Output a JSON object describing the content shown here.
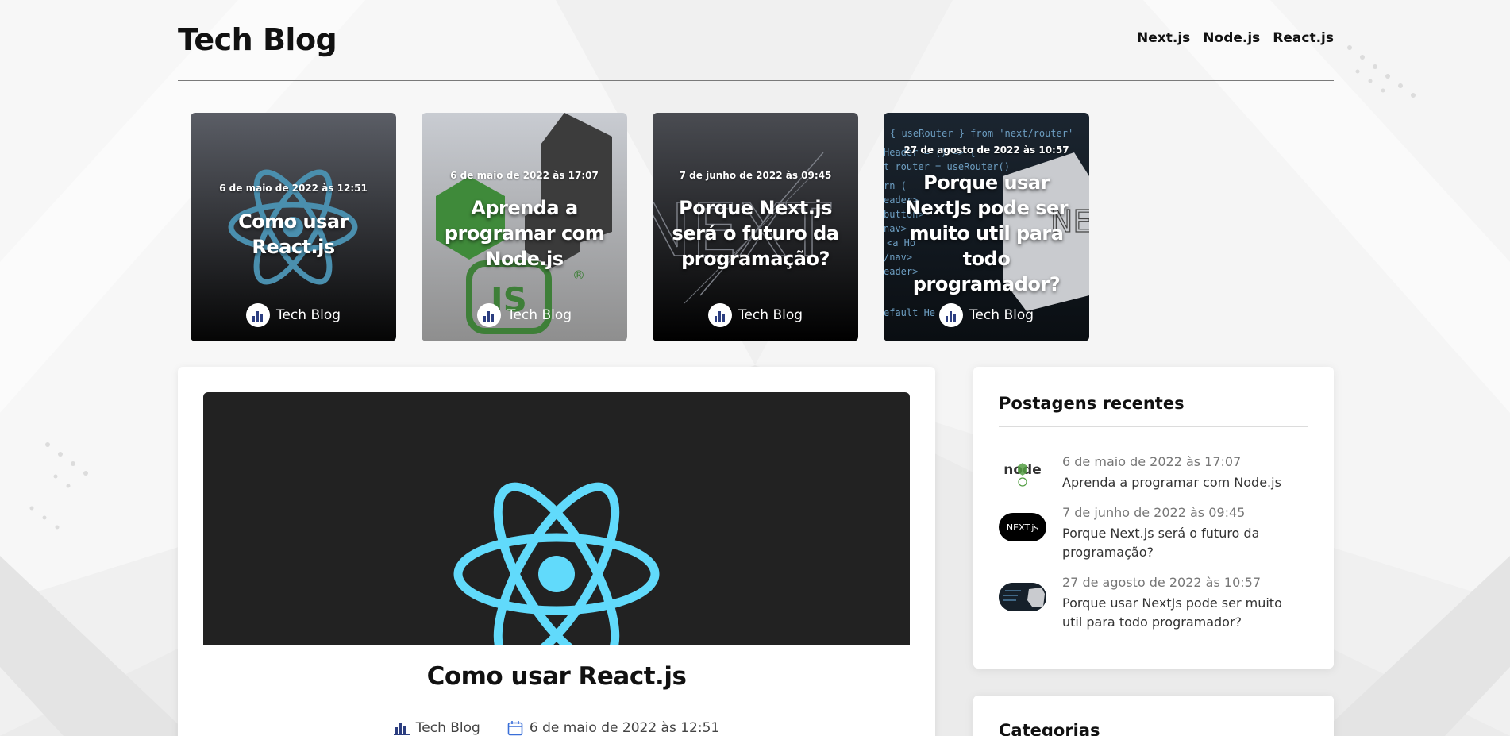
{
  "header": {
    "brand": "Tech Blog",
    "nav": [
      "Next.js",
      "Node.js",
      "React.js"
    ]
  },
  "featured": [
    {
      "date": "6 de maio de 2022 às 12:51",
      "title": "Como usar React.js",
      "author": "Tech Blog",
      "art": "react-logo"
    },
    {
      "date": "6 de maio de 2022 às 17:07",
      "title": "Aprenda a programar com Node.js",
      "author": "Tech Blog",
      "art": "nodejs-logo"
    },
    {
      "date": "7 de junho de 2022 às 09:45",
      "title": "Porque Next.js será o futuro da programação?",
      "author": "Tech Blog",
      "art": "nextjs-logo"
    },
    {
      "date": "27 de agosto de 2022 às 10:57",
      "title": "Porque usar NextJs pode ser muito util para todo programador?",
      "author": "Tech Blog",
      "art": "code-screenshot"
    }
  ],
  "post": {
    "title": "Como usar React.js",
    "author": "Tech Blog",
    "date": "6 de maio de 2022 às 12:51"
  },
  "sidebar": {
    "recent_title": "Postagens recentes",
    "recent": [
      {
        "date": "6 de maio de 2022 às 17:07",
        "title": "Aprenda a programar com Node.js",
        "thumb": "node"
      },
      {
        "date": "7 de junho de 2022 às 09:45",
        "title": "Porque Next.js será o futuro da programação?",
        "thumb": "NEXT.js"
      },
      {
        "date": "27 de agosto de 2022 às 10:57",
        "title": "Porque usar NextJs pode ser muito util para todo programador?",
        "thumb": "code-screenshot"
      }
    ],
    "categories_title": "Categorias"
  },
  "colors": {
    "react": "#61dafb",
    "node_green": "#539e43",
    "hero_bg": "#222222"
  }
}
